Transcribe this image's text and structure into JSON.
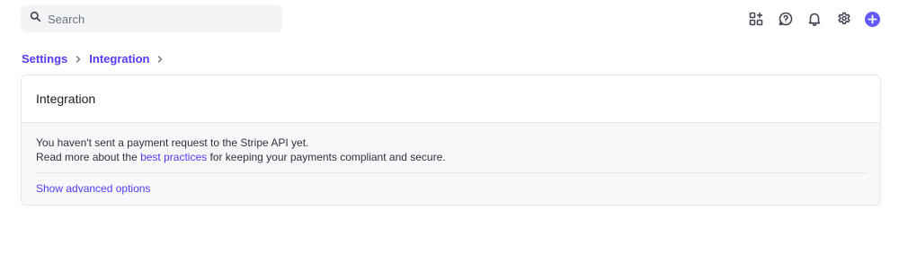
{
  "search": {
    "placeholder": "Search",
    "value": ""
  },
  "header_icons": [
    {
      "name": "apps-icon"
    },
    {
      "name": "help-icon"
    },
    {
      "name": "notifications-icon"
    },
    {
      "name": "settings-icon"
    },
    {
      "name": "create-icon"
    }
  ],
  "breadcrumb": {
    "items": [
      "Settings",
      "Integration"
    ]
  },
  "card": {
    "title": "Integration",
    "message_line1": "You haven't sent a payment request to the Stripe API yet.",
    "message_line2_prefix": "Read more about the ",
    "message_line2_link": "best practices",
    "message_line2_suffix": " for keeping your payments compliant and secure.",
    "advanced_link": "Show advanced options"
  },
  "colors": {
    "accent": "#635bff",
    "link": "#533afd",
    "panel_bg": "#f6f8fa",
    "border": "#e3e8ee"
  }
}
